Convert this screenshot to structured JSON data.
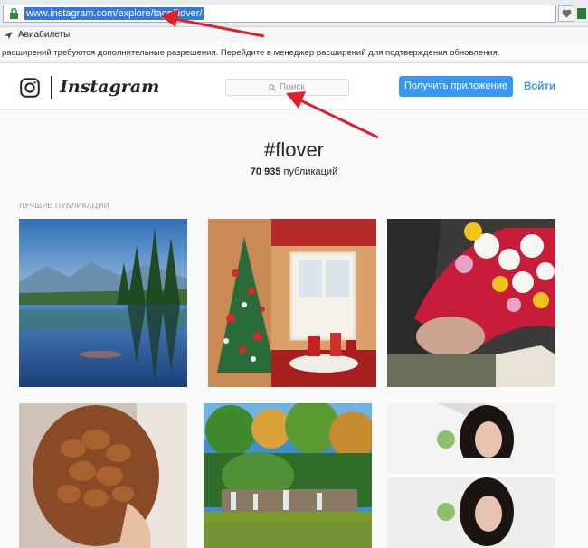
{
  "browser": {
    "url": "www.instagram.com/explore/tags/flover/",
    "bookmarks": [
      {
        "label": "Авиабилеты",
        "icon": "bookmark-plane-icon"
      }
    ],
    "infobar_text": "расширений требуются дополнительные разрешения. Перейдите в менеджер расширений для подтверждения обновления."
  },
  "header": {
    "logo_text": "Instagram",
    "search_placeholder": "Поиск",
    "get_app_label": "Получить приложение",
    "login_label": "Войти"
  },
  "tag": {
    "title": "#flover",
    "count": "70 935",
    "count_suffix": "публикаций"
  },
  "section": {
    "top_posts_label": "ЛУЧШИЕ ПУБЛИКАЦИИ"
  },
  "posts": [
    {
      "kind": "mountain-lake"
    },
    {
      "kind": "christmas-room"
    },
    {
      "kind": "flower-bouquet"
    },
    {
      "kind": "braided-hair"
    },
    {
      "kind": "park-waterfall"
    },
    {
      "kind": "woman-portrait"
    }
  ],
  "colors": {
    "accent": "#3897f0",
    "url_highlight": "#3478d8",
    "annotation_arrow": "#e0202a"
  }
}
